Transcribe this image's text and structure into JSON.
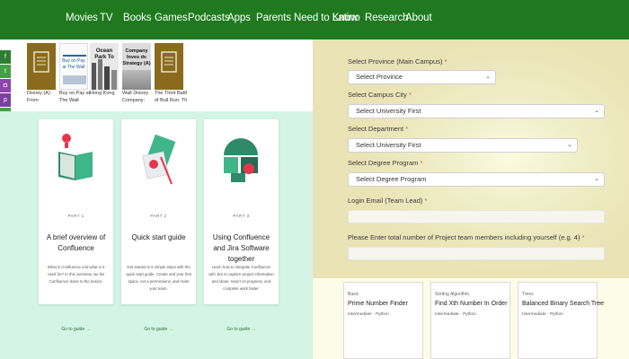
{
  "nav": {
    "items": [
      "Movies",
      "TV",
      "Books",
      "Games",
      "Podcasts",
      "Apps",
      "Parents Need to Know",
      "Latino",
      "Research",
      "About"
    ]
  },
  "colors": {
    "nav_bg": "#1f7a1f",
    "mint_bg": "#d4f5e6",
    "required": "#d9534f"
  },
  "social": [
    {
      "icon": "facebook-icon",
      "glyph": "f",
      "color": "#2e7d32"
    },
    {
      "icon": "twitter-icon",
      "glyph": "t",
      "color": "#43a047"
    },
    {
      "icon": "instagram-icon",
      "glyph": "◘",
      "color": "#8e44ad"
    },
    {
      "icon": "pinterest-icon",
      "glyph": "p",
      "color": "#7b3fa0"
    },
    {
      "icon": "share-icon",
      "glyph": "+",
      "color": "#43a047"
    }
  ],
  "books": [
    {
      "title_lines": [
        "Disney (A):",
        "From"
      ],
      "cover_text": ""
    },
    {
      "title_lines": [
        "Buy on Pay at",
        "The Walt"
      ],
      "cover_text": "Buy on Pay at The Walt"
    },
    {
      "title_lines": [
        "Hong Kong"
      ],
      "cover_text": "Ocean Park To"
    },
    {
      "title_lines": [
        "Walt Disney",
        "Company:"
      ],
      "cover_text": "Company Inves ds Strategy (A)"
    },
    {
      "title_lines": [
        "The Third Battle",
        "of Bull Run: The"
      ],
      "cover_text": ""
    }
  ],
  "guides": [
    {
      "part": "PART 1",
      "title": "A brief overview of Confluence",
      "desc": "What is Confluence and what is it used for? In this overview, we list Confluence down to the basics.",
      "link": "Go to guide →"
    },
    {
      "part": "PART 2",
      "title": "Quick start guide",
      "desc": "Get started in 6 simple steps with the quick start guide. Create and your first space, set a permissions, and invite your team.",
      "link": "Go to guide →"
    },
    {
      "part": "PART 3",
      "title": "Using Confluence and Jira Software together",
      "desc": "Learn how to integrate Confluence with Jira to capture project information and ideas, report on progress, and complete work faster.",
      "link": "Go to guide →"
    }
  ],
  "form": {
    "province": {
      "label": "Select Province (Main Campus)",
      "value": "Select Province"
    },
    "campus": {
      "label": "Select Campus City",
      "value": "Select University First"
    },
    "department": {
      "label": "Select Department",
      "value": "Select University First"
    },
    "degree": {
      "label": "Select Degree Program",
      "value": "Select Degree Program"
    },
    "email": {
      "label": "Login Email (Team Lead)",
      "value": ""
    },
    "members": {
      "label": "Please Enter total number of Project team members including yourself (e.g. 4)",
      "value": ""
    },
    "required_mark": "*"
  },
  "problems": [
    {
      "category": "Basic",
      "title": "Prime Number Finder",
      "level": "Intermediate",
      "lang": "Python"
    },
    {
      "category": "Sorting Algorithm",
      "title": "Find Xth Number In Order",
      "level": "Intermediate",
      "lang": "Python"
    },
    {
      "category": "Trees",
      "title": "Balanced Binary Search Tree",
      "level": "Intermediate",
      "lang": "Python"
    }
  ]
}
